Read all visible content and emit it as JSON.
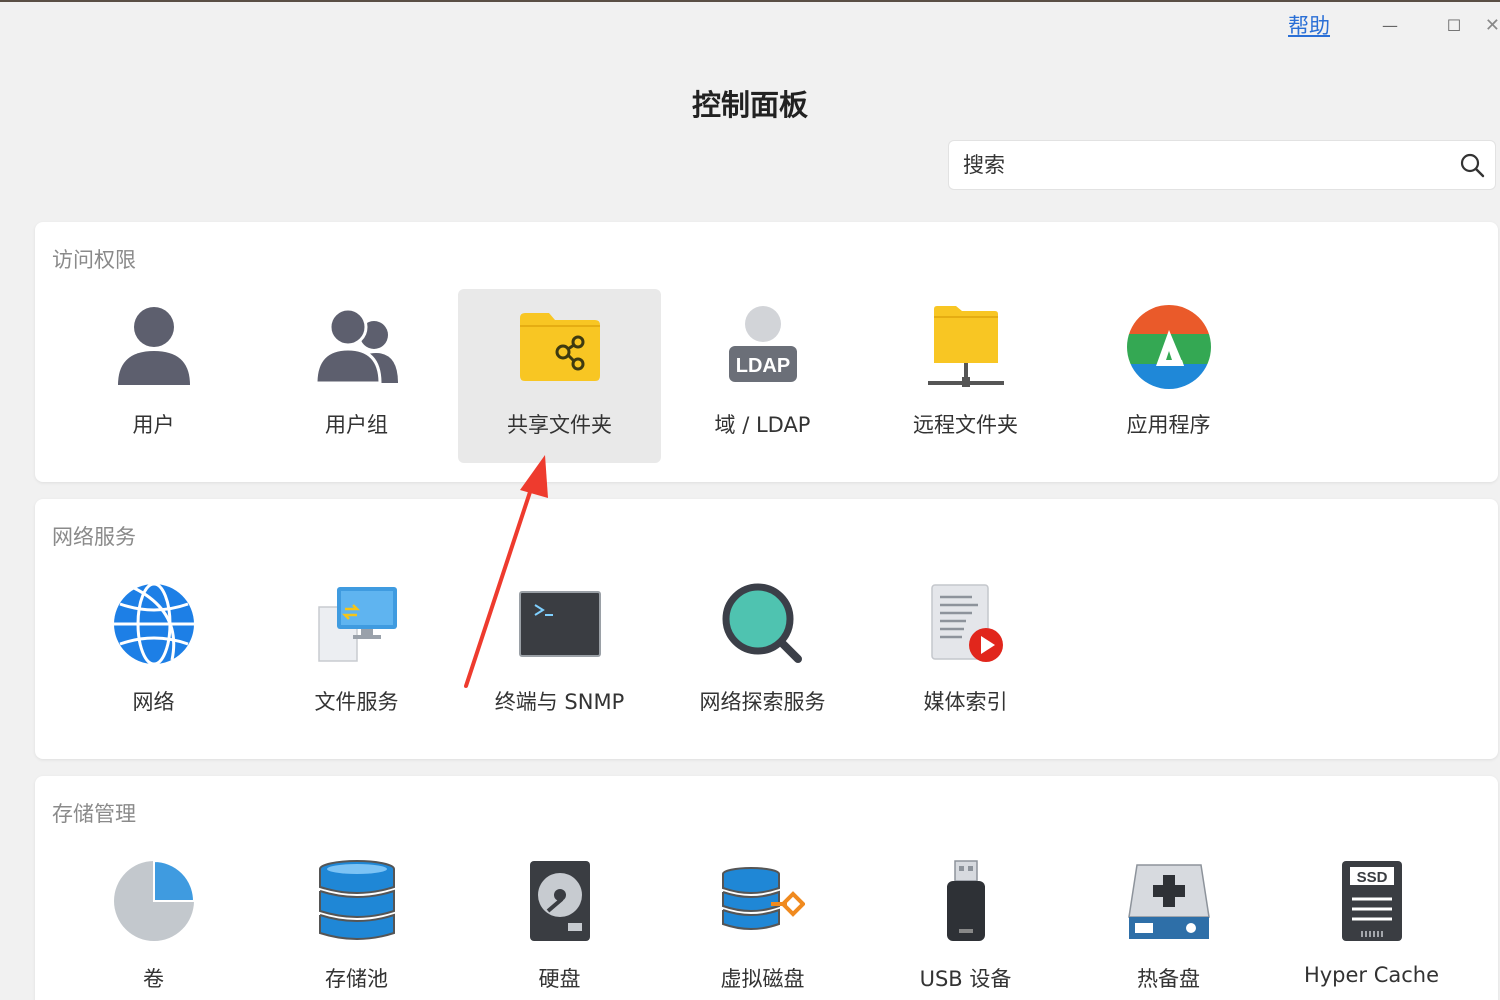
{
  "window": {
    "help_label": "帮助",
    "minimize_symbol": "—",
    "maximize_symbol": "☐",
    "close_symbol": "✕"
  },
  "header": {
    "title": "控制面板"
  },
  "search": {
    "placeholder": "搜索",
    "value": ""
  },
  "sections": [
    {
      "title": "访问权限",
      "items": [
        {
          "label": "用户",
          "icon": "user-icon"
        },
        {
          "label": "用户组",
          "icon": "user-group-icon"
        },
        {
          "label": "共享文件夹",
          "icon": "shared-folder-icon",
          "selected": true
        },
        {
          "label": "域 / LDAP",
          "icon": "ldap-icon"
        },
        {
          "label": "远程文件夹",
          "icon": "remote-folder-icon"
        },
        {
          "label": "应用程序",
          "icon": "app-icon"
        }
      ]
    },
    {
      "title": "网络服务",
      "items": [
        {
          "label": "网络",
          "icon": "network-globe-icon"
        },
        {
          "label": "文件服务",
          "icon": "file-service-icon"
        },
        {
          "label": "终端与 SNMP",
          "icon": "terminal-icon"
        },
        {
          "label": "网络探索服务",
          "icon": "network-discovery-icon"
        },
        {
          "label": "媒体索引",
          "icon": "media-index-icon"
        }
      ]
    },
    {
      "title": "存储管理",
      "items": [
        {
          "label": "卷",
          "icon": "volume-pie-icon"
        },
        {
          "label": "存储池",
          "icon": "storage-pool-icon"
        },
        {
          "label": "硬盘",
          "icon": "hard-disk-icon"
        },
        {
          "label": "虚拟磁盘",
          "icon": "virtual-disk-icon"
        },
        {
          "label": "USB 设备",
          "icon": "usb-device-icon"
        },
        {
          "label": "热备盘",
          "icon": "hot-spare-icon"
        },
        {
          "label": "Hyper Cache",
          "icon": "ssd-icon"
        }
      ]
    }
  ],
  "annotation": {
    "arrow_color": "#ee3b2e",
    "target": "共享文件夹"
  },
  "colors": {
    "accent_link": "#2a6fd6",
    "selected_tile": "#e9e9e9",
    "folder_yellow": "#f8c623"
  },
  "icon_text": {
    "ldap": "LDAP",
    "ssd": "SSD"
  }
}
